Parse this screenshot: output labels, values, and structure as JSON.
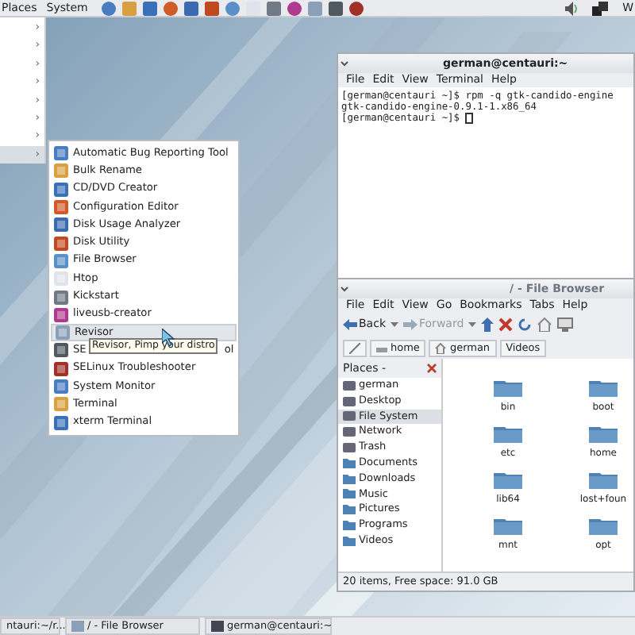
{
  "top_panel": {
    "menus": [
      "Places",
      "System"
    ],
    "clipped_right": "W"
  },
  "main_menu": {
    "arrows": [
      {
        "glyph": "›",
        "selected": false
      },
      {
        "glyph": "›",
        "selected": false
      },
      {
        "glyph": "›",
        "selected": false
      },
      {
        "glyph": "›",
        "selected": false
      },
      {
        "glyph": "›",
        "selected": false
      },
      {
        "glyph": "›",
        "selected": false
      },
      {
        "glyph": "›",
        "selected": false
      },
      {
        "glyph": "›",
        "selected": true
      }
    ]
  },
  "submenu": {
    "items": [
      {
        "label": "Automatic Bug Reporting Tool",
        "selected": false
      },
      {
        "label": "Bulk Rename",
        "selected": false
      },
      {
        "label": "CD/DVD Creator",
        "selected": false
      },
      {
        "label": "Configuration Editor",
        "selected": false
      },
      {
        "label": "Disk Usage Analyzer",
        "selected": false
      },
      {
        "label": "Disk Utility",
        "selected": false
      },
      {
        "label": "File Browser",
        "selected": false
      },
      {
        "label": "Htop",
        "selected": false
      },
      {
        "label": "Kickstart",
        "selected": false
      },
      {
        "label": "liveusb-creator",
        "selected": false
      },
      {
        "label": "Revisor",
        "selected": true
      },
      {
        "label": "SE",
        "label_end": "ol",
        "selected": false
      },
      {
        "label": "SELinux Troubleshooter",
        "selected": false
      },
      {
        "label": "System Monitor",
        "selected": false
      },
      {
        "label": "Terminal",
        "selected": false
      },
      {
        "label": "xterm Terminal",
        "selected": false
      }
    ]
  },
  "tooltip": {
    "text": "Revisor, Pimp your distro"
  },
  "terminal": {
    "title": "german@centauri:~",
    "menus": [
      "File",
      "Edit",
      "View",
      "Terminal",
      "Help"
    ],
    "lines": [
      "[german@centauri ~]$ rpm -q gtk-candido-engine",
      "gtk-candido-engine-0.9.1-1.x86_64",
      "[german@centauri ~]$ "
    ]
  },
  "file_browser": {
    "title": "/ - File Browser",
    "menus": [
      "File",
      "Edit",
      "View",
      "Go",
      "Bookmarks",
      "Tabs",
      "Help"
    ],
    "back": "Back",
    "forward": "Forward",
    "path": [
      "home",
      "german",
      "Videos"
    ],
    "places_header": "Places -",
    "places": [
      {
        "label": "german",
        "selected": false
      },
      {
        "label": "Desktop",
        "selected": false
      },
      {
        "label": "File System",
        "selected": true
      },
      {
        "label": "Network",
        "selected": false
      },
      {
        "label": "Trash",
        "selected": false
      },
      {
        "label": "Documents",
        "selected": false
      },
      {
        "label": "Downloads",
        "selected": false
      },
      {
        "label": "Music",
        "selected": false
      },
      {
        "label": "Pictures",
        "selected": false
      },
      {
        "label": "Programs",
        "selected": false
      },
      {
        "label": "Videos",
        "selected": false
      }
    ],
    "files": [
      "bin",
      "boot",
      "etc",
      "home",
      "lib64",
      "lost+foun",
      "mnt",
      "opt"
    ],
    "status": "20 items, Free space: 91.0 GB"
  },
  "taskbar": [
    {
      "label": "ntauri:~/r..."
    },
    {
      "label": "/ - File Browser"
    },
    {
      "label": "german@centauri:~"
    }
  ]
}
